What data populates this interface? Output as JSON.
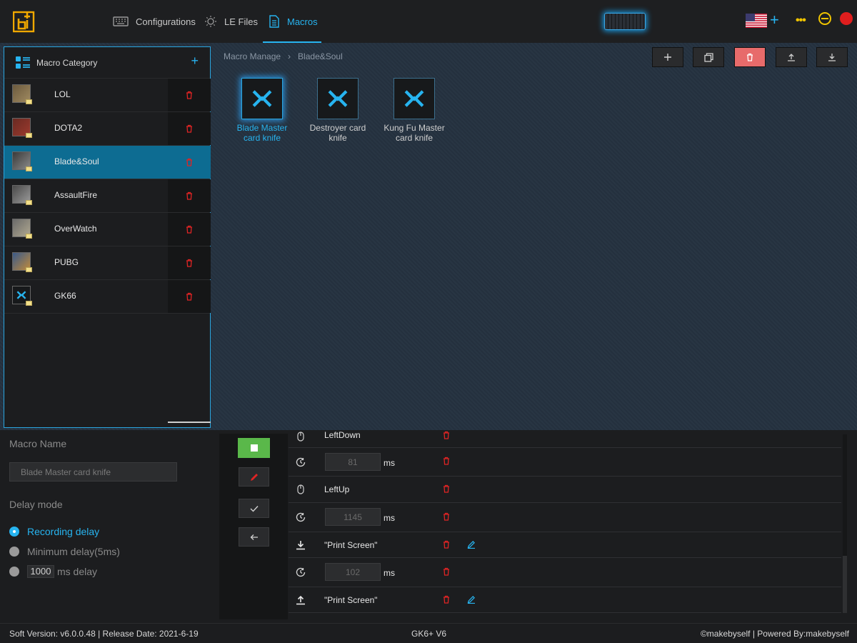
{
  "nav": {
    "items": [
      {
        "label": "Configurations",
        "icon": "keyboard-icon"
      },
      {
        "label": "LE Files",
        "icon": "lightbulb-icon"
      },
      {
        "label": "Macros",
        "icon": "document-icon",
        "active": true
      }
    ],
    "accent": "#27b4f0"
  },
  "sidebar": {
    "title": "Macro Category",
    "categories": [
      {
        "label": "LOL"
      },
      {
        "label": "DOTA2"
      },
      {
        "label": "Blade&Soul",
        "selected": true
      },
      {
        "label": "AssaultFire"
      },
      {
        "label": "OverWatch"
      },
      {
        "label": "PUBG"
      },
      {
        "label": "GK66"
      }
    ]
  },
  "breadcrumb": {
    "root": "Macro Manage",
    "current": "Blade&Soul"
  },
  "macros": [
    {
      "label": "Blade Master card knife",
      "active": true
    },
    {
      "label": "Destroyer card knife"
    },
    {
      "label": "Kung Fu Master card knife"
    }
  ],
  "editor": {
    "name_label": "Macro Name",
    "name_value": "Blade Master card knife",
    "delay_mode_label": "Delay mode",
    "delay_options": [
      "Recording delay",
      "Minimum delay(5ms)",
      "ms delay"
    ],
    "fixed_delay_value": "1000",
    "selected_delay": "Recording delay"
  },
  "steps": [
    {
      "type": "mouse",
      "text": "LeftDown"
    },
    {
      "type": "delay",
      "value": "81",
      "unit": "ms"
    },
    {
      "type": "mouse",
      "text": "LeftUp"
    },
    {
      "type": "delay",
      "value": "1145",
      "unit": "ms"
    },
    {
      "type": "keydown",
      "text": "\"Print Screen\""
    },
    {
      "type": "delay",
      "value": "102",
      "unit": "ms"
    },
    {
      "type": "keyup",
      "text": "\"Print Screen\""
    }
  ],
  "footer": {
    "left": "Soft Version: v6.0.0.48 | Release Date: 2021-6-19",
    "center": "GK6+ V6",
    "right": "©makebyself | Powered By:makebyself"
  },
  "colors": {
    "accent": "#27b4f0",
    "danger": "#e02424",
    "selected_row": "#0d6c92",
    "warning": "#f0c400"
  }
}
